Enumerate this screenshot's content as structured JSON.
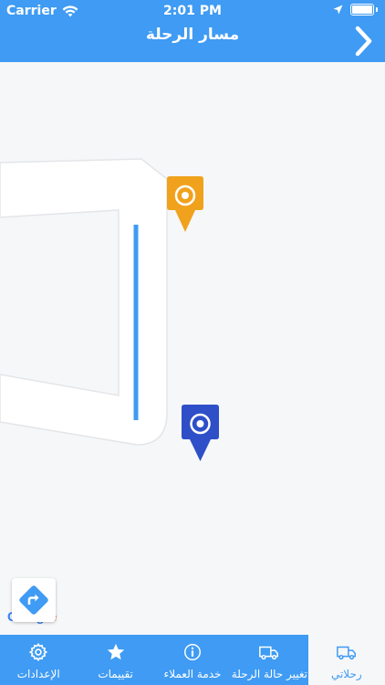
{
  "status_bar": {
    "carrier": "Carrier",
    "time": "2:01 PM"
  },
  "header": {
    "title": "مسار الرحلة",
    "back_icon": "chevron-right-icon"
  },
  "map": {
    "route_color": "#3f9bf3",
    "start_pin_color": "#f0a21d",
    "end_pin_color": "#2e4fc8",
    "google_logo": [
      "G",
      "o",
      "o",
      "g",
      "l",
      "e"
    ],
    "google_colors": [
      "#4285f4",
      "#ea4335",
      "#fbbc05",
      "#4285f4",
      "#34a853",
      "#ea4335"
    ]
  },
  "tabs": [
    {
      "label": "الإعدادات",
      "icon": "gear-icon",
      "active": false
    },
    {
      "label": "تقييمات",
      "icon": "star-icon",
      "active": false
    },
    {
      "label": "خدمة العملاء",
      "icon": "support-icon",
      "active": false
    },
    {
      "label": "تغيير حالة الرحلة",
      "icon": "truck-icon",
      "active": false
    },
    {
      "label": "رحلاتي",
      "icon": "truck-icon",
      "active": true
    }
  ],
  "colors": {
    "brand": "#3f9bf3",
    "background": "#f6f7f9"
  }
}
